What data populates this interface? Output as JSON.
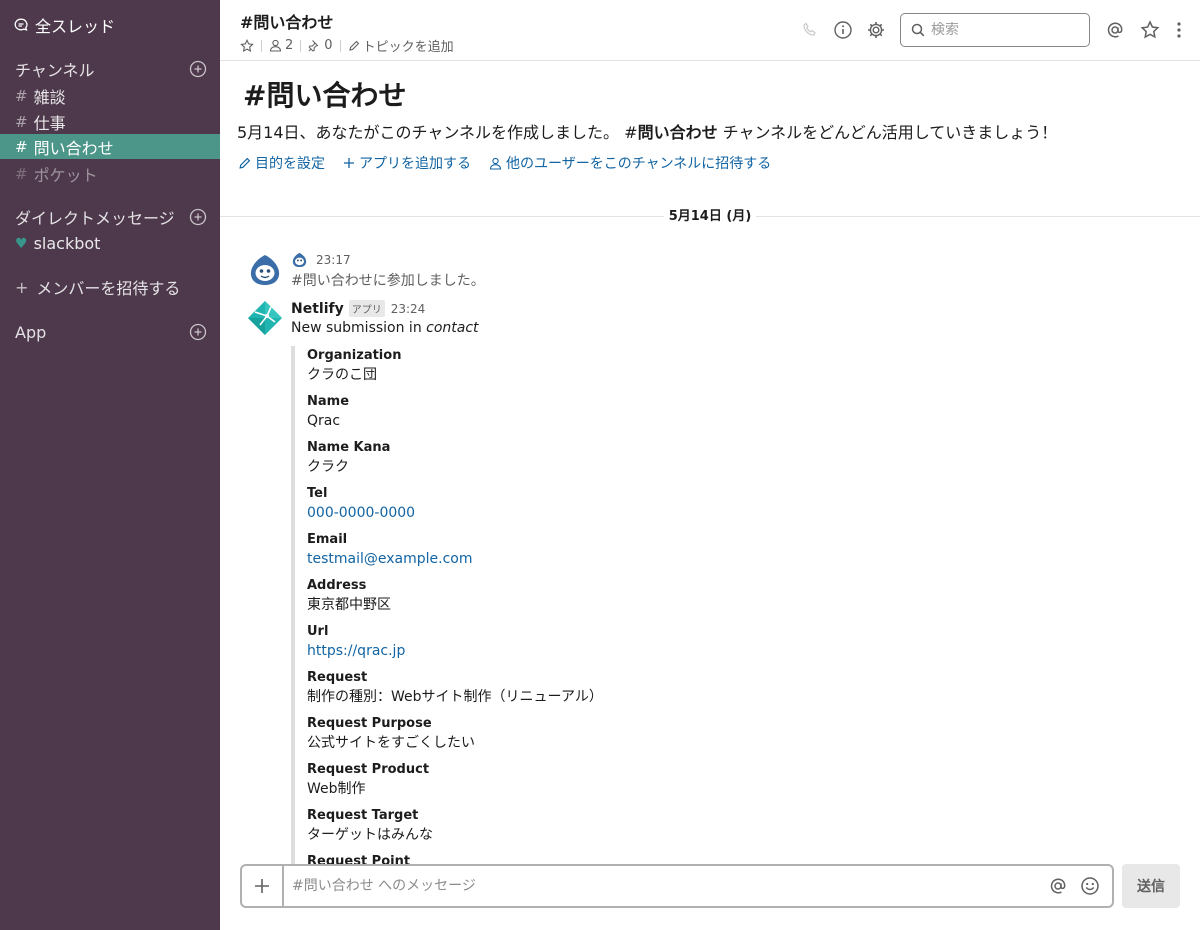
{
  "sidebar": {
    "threads_label": "全スレッド",
    "channels_label": "チャンネル",
    "channels": [
      {
        "name": "雑談"
      },
      {
        "name": "仕事"
      },
      {
        "name": "問い合わせ"
      },
      {
        "name": "ポケット"
      }
    ],
    "dm_label": "ダイレクトメッセージ",
    "dms": [
      {
        "name": "slackbot"
      }
    ],
    "invite_label": "メンバーを招待する",
    "app_label": "App"
  },
  "header": {
    "title": "#問い合わせ",
    "member_count": "2",
    "pin_count": "0",
    "topic_label": "トピックを追加",
    "search_placeholder": "検索"
  },
  "intro": {
    "title": "問い合わせ",
    "text_prefix": "5月14日、あなたがこのチャンネルを作成しました。 #",
    "channel_bold": "問い合わせ",
    "text_suffix": " チャンネルをどんどん活用していきましょう！",
    "links": [
      "目的を設定",
      "アプリを追加する",
      "他のユーザーをこのチャンネルに招待する"
    ]
  },
  "date_divider": "5月14日 (月)",
  "messages": {
    "first": {
      "time": "23:17",
      "text": "#問い合わせに参加しました。"
    },
    "second": {
      "sender": "Netlify",
      "badge": "アプリ",
      "time": "23:24",
      "text_prefix": "New submission in ",
      "text_em": "contact"
    }
  },
  "attachment": {
    "fields": [
      {
        "label": "Organization",
        "value": "クラのこ団",
        "link": false
      },
      {
        "label": "Name",
        "value": "Qrac",
        "link": false
      },
      {
        "label": "Name Kana",
        "value": "クラク",
        "link": false
      },
      {
        "label": "Tel",
        "value": "000-0000-0000",
        "link": true
      },
      {
        "label": "Email",
        "value": "testmail@example.com",
        "link": true
      },
      {
        "label": "Address",
        "value": "東京都中野区",
        "link": false
      },
      {
        "label": "Url",
        "value": "https://qrac.jp",
        "link": true
      },
      {
        "label": "Request",
        "value": "制作の種別：Webサイト制作（リニューアル）",
        "link": false
      },
      {
        "label": "Request Purpose",
        "value": "公式サイトをすごくしたい",
        "link": false
      },
      {
        "label": "Request Product",
        "value": "Web制作",
        "link": false
      },
      {
        "label": "Request Target",
        "value": "ターゲットはみんな",
        "link": false
      },
      {
        "label": "Request Point",
        "value": "",
        "link": false
      }
    ]
  },
  "composer": {
    "placeholder": "#問い合わせ へのメッセージ",
    "send_label": "送信"
  },
  "colors": {
    "sidebar_bg": "#4d394b",
    "active_channel": "#4c9689",
    "link": "#1264a3"
  }
}
